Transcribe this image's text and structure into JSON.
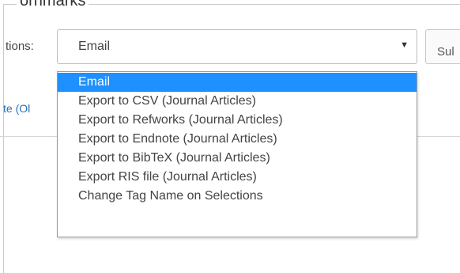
{
  "fieldset": {
    "legend": "ornmarks"
  },
  "actions": {
    "label": "tions:",
    "select_value": "Email",
    "submit_label": "Sul",
    "options": [
      "Email",
      "Export to CSV (Journal Articles)",
      "Export to Refworks (Journal Articles)",
      "Export to Endnote (Journal Articles)",
      "Export to BibTeX (Journal Articles)",
      "Export RIS file (Journal Articles)",
      "Change Tag Name on Selections"
    ],
    "selected_index": 0
  },
  "side_link": "te (Ol",
  "colors": {
    "highlight": "#1e90ff",
    "link": "#2a6fb0"
  }
}
